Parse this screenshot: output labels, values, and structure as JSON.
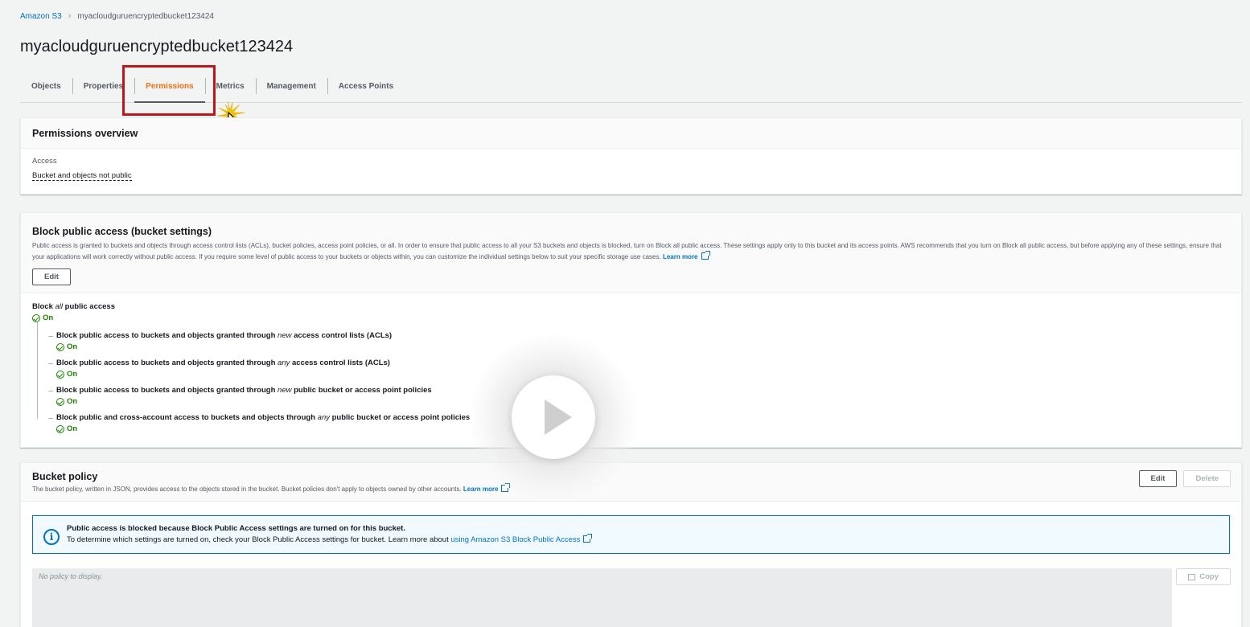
{
  "breadcrumb": {
    "root": "Amazon S3",
    "current": "myacloudguruencryptedbucket123424"
  },
  "page_title": "myacloudguruencryptedbucket123424",
  "tabs": [
    {
      "label": "Objects"
    },
    {
      "label": "Properties"
    },
    {
      "label": "Permissions"
    },
    {
      "label": "Metrics"
    },
    {
      "label": "Management"
    },
    {
      "label": "Access Points"
    }
  ],
  "active_tab": "Permissions",
  "overview": {
    "title": "Permissions overview",
    "access_label": "Access",
    "access_value": "Bucket and objects not public"
  },
  "block_public_access": {
    "title": "Block public access (bucket settings)",
    "description": "Public access is granted to buckets and objects through access control lists (ACLs), bucket policies, access point policies, or all. In order to ensure that public access to all your S3 buckets and objects is blocked, turn on Block all public access. These settings apply only to this bucket and its access points. AWS recommends that you turn on Block all public access, but before applying any of these settings, ensure that your applications will work correctly without public access. If you require some level of public access to your buckets or objects within, you can customize the individual settings below to suit your specific storage use cases.",
    "learn_more": "Learn more",
    "edit_label": "Edit",
    "main": {
      "pre": "Block ",
      "em": "all",
      "post": " public access",
      "status": "On"
    },
    "items": [
      {
        "pre": "Block public access to buckets and objects granted through ",
        "em": "new",
        "post": " access control lists (ACLs)",
        "status": "On"
      },
      {
        "pre": "Block public access to buckets and objects granted through ",
        "em": "any",
        "post": " access control lists (ACLs)",
        "status": "On"
      },
      {
        "pre": "Block public access to buckets and objects granted through ",
        "em": "new",
        "post": " public bucket or access point policies",
        "status": "On"
      },
      {
        "pre": "Block public and cross-account access to buckets and objects through ",
        "em": "any",
        "post": " public bucket or access point policies",
        "status": "On"
      }
    ]
  },
  "bucket_policy": {
    "title": "Bucket policy",
    "description": "The bucket policy, written in JSON, provides access to the objects stored in the bucket. Bucket policies don't apply to objects owned by other accounts.",
    "learn_more": "Learn more",
    "edit_label": "Edit",
    "delete_label": "Delete",
    "info_title": "Public access is blocked because Block Public Access settings are turned on for this bucket.",
    "info_text": "To determine which settings are turned on, check your Block Public Access settings for bucket. Learn more about",
    "info_link": "using Amazon S3 Block Public Access",
    "placeholder": "No policy to display.",
    "copy_label": "Copy"
  },
  "colors": {
    "accent": "#ec7211",
    "link": "#0073bb",
    "success": "#1d8102",
    "highlight": "#c0141b"
  }
}
